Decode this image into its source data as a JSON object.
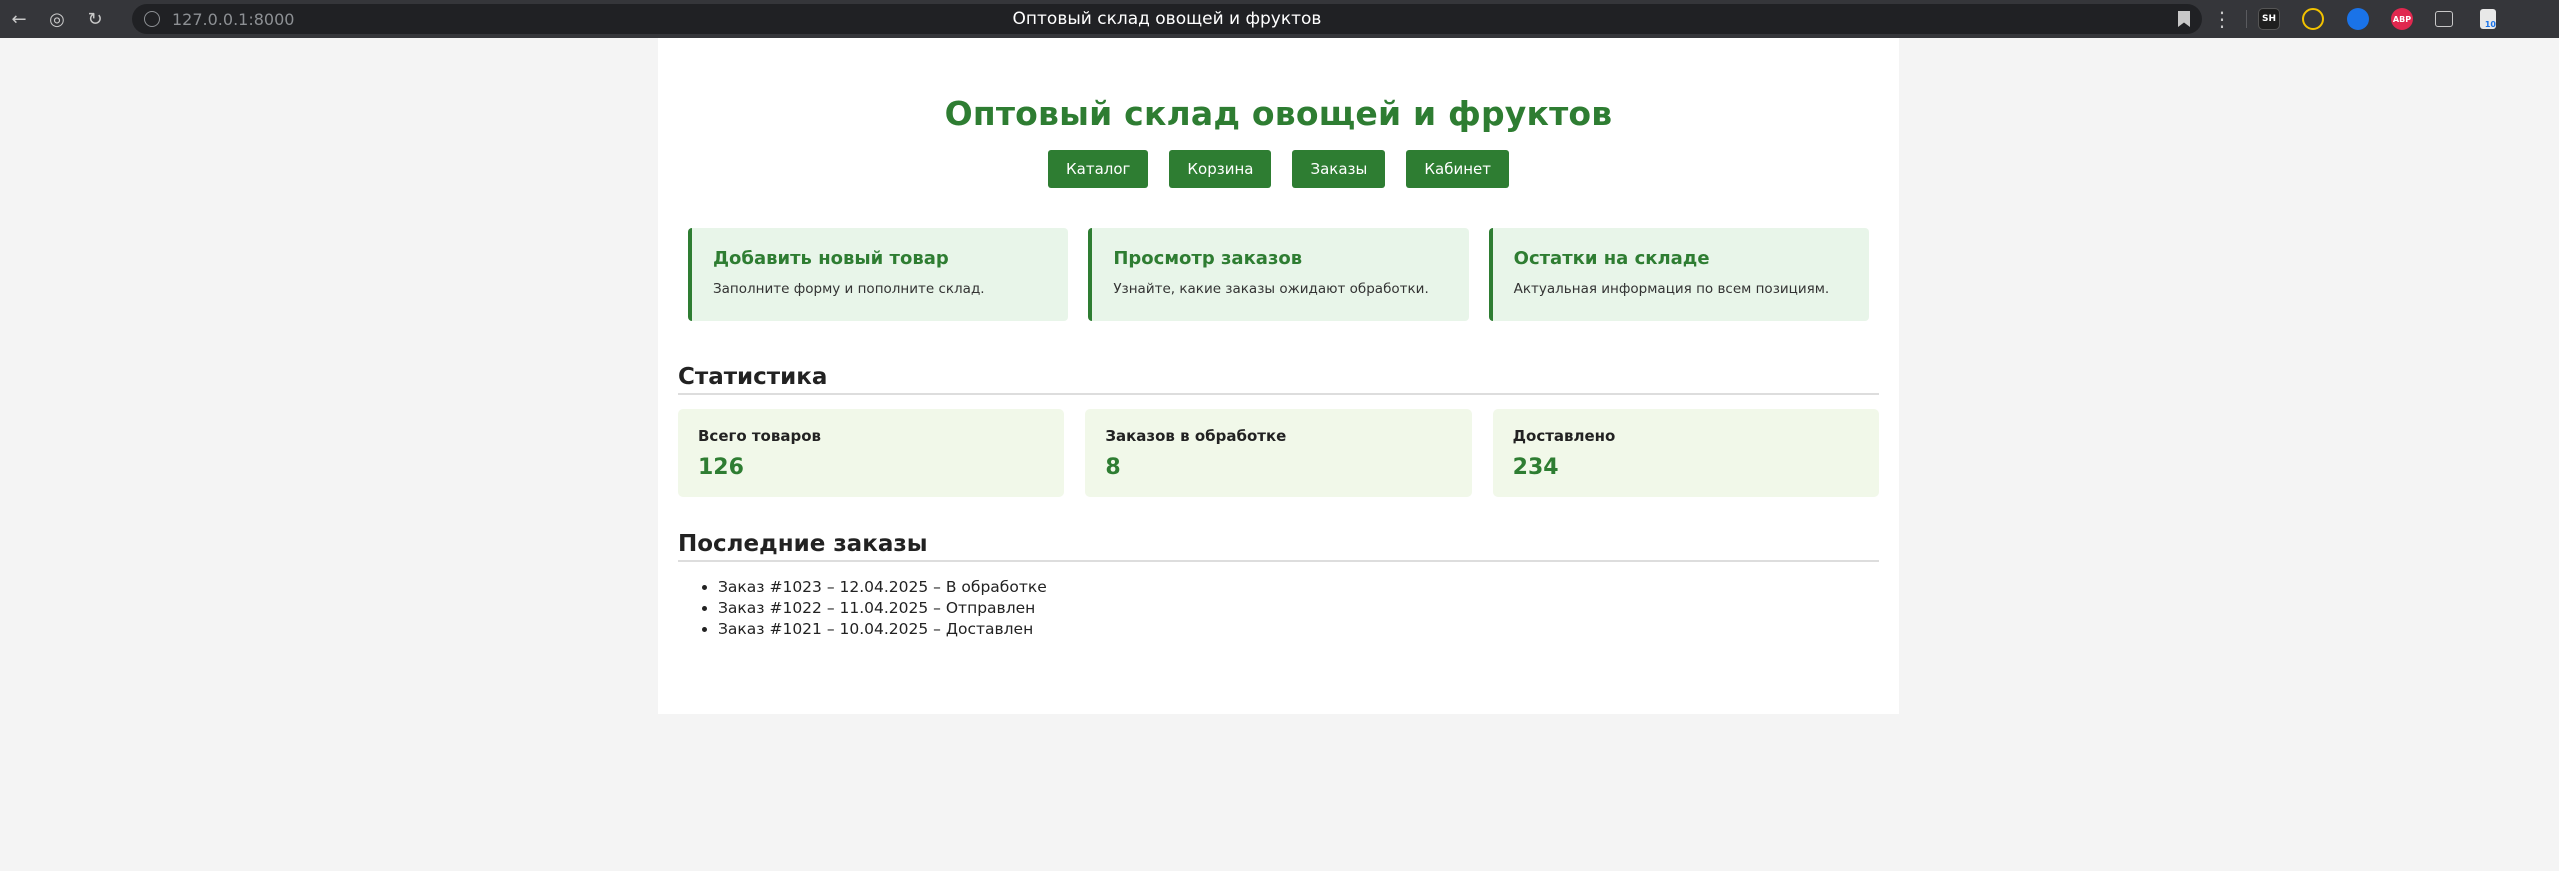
{
  "browser": {
    "url": "127.0.0.1:8000",
    "tab_title": "Оптовый склад овощей и фруктов",
    "extensions": [
      {
        "name": "sh-extension-icon",
        "label": "SH",
        "color": "#1f1f1f"
      },
      {
        "name": "yellow-extension-icon",
        "label": "",
        "color": "#f2c200"
      },
      {
        "name": "shazam-extension-icon",
        "label": "",
        "color": "#1a73e8"
      },
      {
        "name": "adblock-extension-icon",
        "label": "ABP",
        "color": "#e0284f"
      },
      {
        "name": "puzzle-extension-icon",
        "label": "",
        "color": "#35363a"
      },
      {
        "name": "profile-extension-icon",
        "label": "10",
        "color": "#35363a"
      }
    ]
  },
  "header": {
    "title": "Оптовый склад овощей и фруктов"
  },
  "nav": {
    "items": [
      "Каталог",
      "Корзина",
      "Заказы",
      "Кабинет"
    ]
  },
  "cards": [
    {
      "title": "Добавить новый товар",
      "text": "Заполните форму и пополните склад."
    },
    {
      "title": "Просмотр заказов",
      "text": "Узнайте, какие заказы ожидают обработки."
    },
    {
      "title": "Остатки на складе",
      "text": "Актуальная информация по всем позициям."
    }
  ],
  "stats": {
    "heading": "Статистика",
    "items": [
      {
        "label": "Всего товаров",
        "value": "126"
      },
      {
        "label": "Заказов в обработке",
        "value": "8"
      },
      {
        "label": "Доставлено",
        "value": "234"
      }
    ]
  },
  "orders": {
    "heading": "Последние заказы",
    "items": [
      "Заказ #1023 – 12.04.2025 – В обработке",
      "Заказ #1022 – 11.04.2025 – Отправлен",
      "Заказ #1021 – 10.04.2025 – Доставлен"
    ]
  },
  "colors": {
    "accent": "#2e7d32",
    "card_bg": "#e8f5e9",
    "stat_bg": "#f1f8e9",
    "page_bg": "#f4f4f4"
  }
}
